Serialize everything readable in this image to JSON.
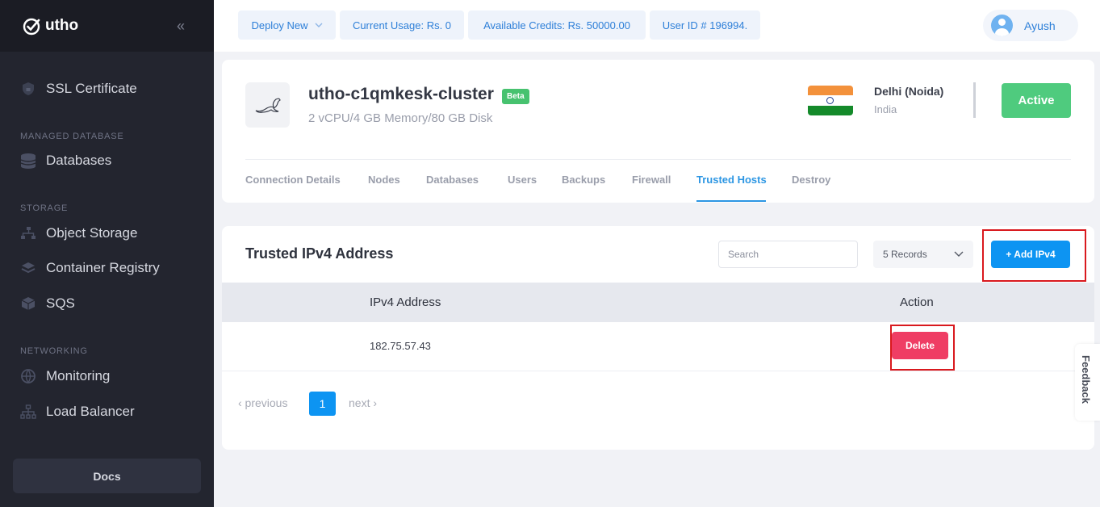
{
  "brand": {
    "name": "utho"
  },
  "sidebar": {
    "collapse_icon": "double-chevron-left-icon",
    "items_top": [
      {
        "label": "SSL Certificate",
        "icon": "shield-icon"
      }
    ],
    "sections": [
      {
        "title": "MANAGED DATABASE",
        "items": [
          {
            "label": "Databases",
            "icon": "database-icon"
          }
        ]
      },
      {
        "title": "STORAGE",
        "items": [
          {
            "label": "Object Storage",
            "icon": "object-storage-icon"
          },
          {
            "label": "Container Registry",
            "icon": "layers-icon"
          },
          {
            "label": "SQS",
            "icon": "stack-icon"
          }
        ]
      },
      {
        "title": "NETWORKING",
        "items": [
          {
            "label": "Monitoring",
            "icon": "globe-icon"
          },
          {
            "label": "Load Balancer",
            "icon": "network-icon"
          }
        ]
      }
    ],
    "docs_label": "Docs"
  },
  "topbar": {
    "deploy_label": "Deploy New",
    "usage": "Current Usage: Rs. 0",
    "credits": "Available Credits: Rs. 50000.00",
    "user_id": "User ID # 196994.",
    "user_name": "Ayush"
  },
  "cluster": {
    "name": "utho-c1qmkesk-cluster",
    "badge": "Beta",
    "spec": "2 vCPU/4 GB Memory/80 GB Disk",
    "city": "Delhi (Noida)",
    "country": "India",
    "status": "Active",
    "tabs": [
      "Connection Details",
      "Nodes",
      "Databases",
      "Users",
      "Backups",
      "Firewall",
      "Trusted Hosts",
      "Destroy"
    ],
    "active_tab": "Trusted Hosts"
  },
  "trusted": {
    "title": "Trusted IPv4 Address",
    "search_placeholder": "Search",
    "records_label": "5 Records",
    "add_label": "+ Add IPv4",
    "columns": [
      "IPv4 Address",
      "Action"
    ],
    "rows": [
      {
        "ip": "182.75.57.43",
        "action": "Delete"
      }
    ],
    "pagination": {
      "prev": "‹ previous",
      "page": "1",
      "next": "next ›"
    }
  },
  "feedback_label": "Feedback",
  "colors": {
    "accent": "#0d94f2",
    "active": "#4fcb7e",
    "danger": "#ef3d64",
    "highlight": "#d9191e"
  }
}
